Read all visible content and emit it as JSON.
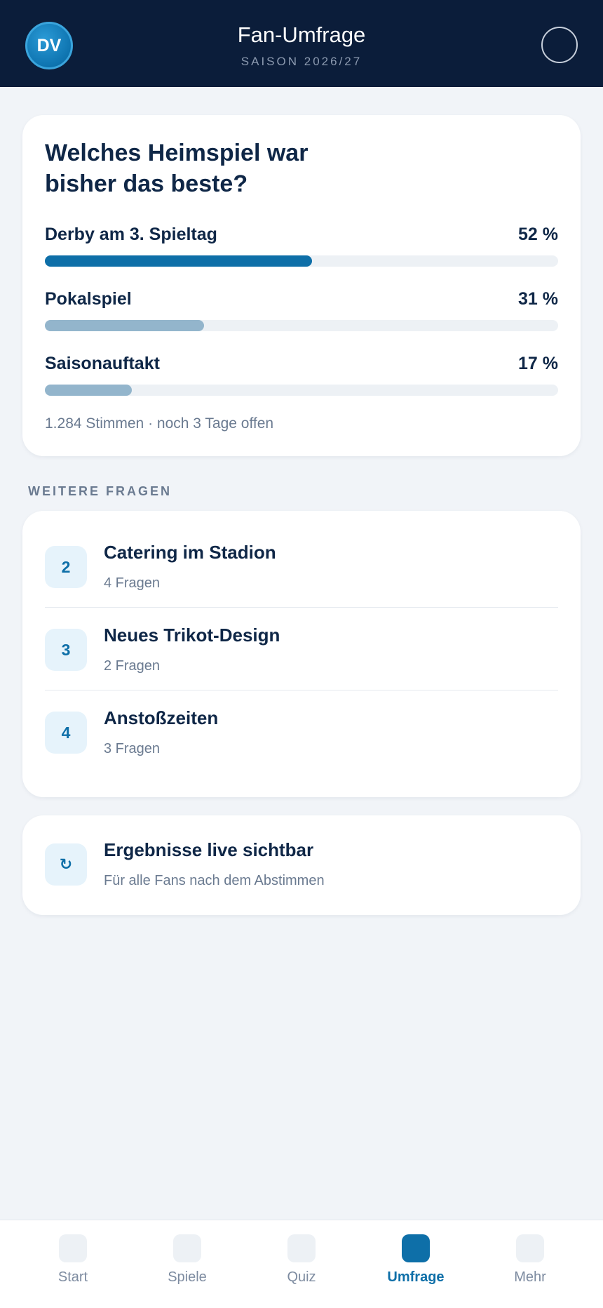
{
  "header": {
    "avatar_initials": "DV",
    "title": "Fan-Umfrage",
    "subtitle": "SAISON 2026/27"
  },
  "poll": {
    "question": "Welches Heimspiel war bisher das beste?",
    "options": [
      {
        "label": "Derby am 3. Spieltag",
        "percent_text": "52 %",
        "percent": 52,
        "color": "#0e6fa8"
      },
      {
        "label": "Pokalspiel",
        "percent_text": "31 %",
        "percent": 31,
        "color": "#93b5cc"
      },
      {
        "label": "Saisonauftakt",
        "percent_text": "17 %",
        "percent": 17,
        "color": "#93b5cc"
      }
    ],
    "footer": "1.284 Stimmen · noch 3 Tage offen"
  },
  "section_label": "WEITERE FRAGEN",
  "questions": [
    {
      "number": "2",
      "title": "Catering im Stadion",
      "subtitle": "4 Fragen"
    },
    {
      "number": "3",
      "title": "Neues Trikot-Design",
      "subtitle": "2 Fragen"
    },
    {
      "number": "4",
      "title": "Anstoßzeiten",
      "subtitle": "3 Fragen"
    }
  ],
  "info": {
    "icon": "↻",
    "icon_name": "refresh-icon",
    "title": "Ergebnisse live sichtbar",
    "subtitle": "Für alle Fans nach dem Abstimmen"
  },
  "nav": {
    "items": [
      {
        "label": "Start",
        "active": false
      },
      {
        "label": "Spiele",
        "active": false
      },
      {
        "label": "Quiz",
        "active": false
      },
      {
        "label": "Umfrage",
        "active": true
      },
      {
        "label": "Mehr",
        "active": false
      }
    ]
  },
  "colors": {
    "header_bg": "#0b1d3a",
    "accent": "#0e6fa8",
    "bar_secondary": "#93b5cc",
    "page_bg": "#f1f4f8"
  }
}
